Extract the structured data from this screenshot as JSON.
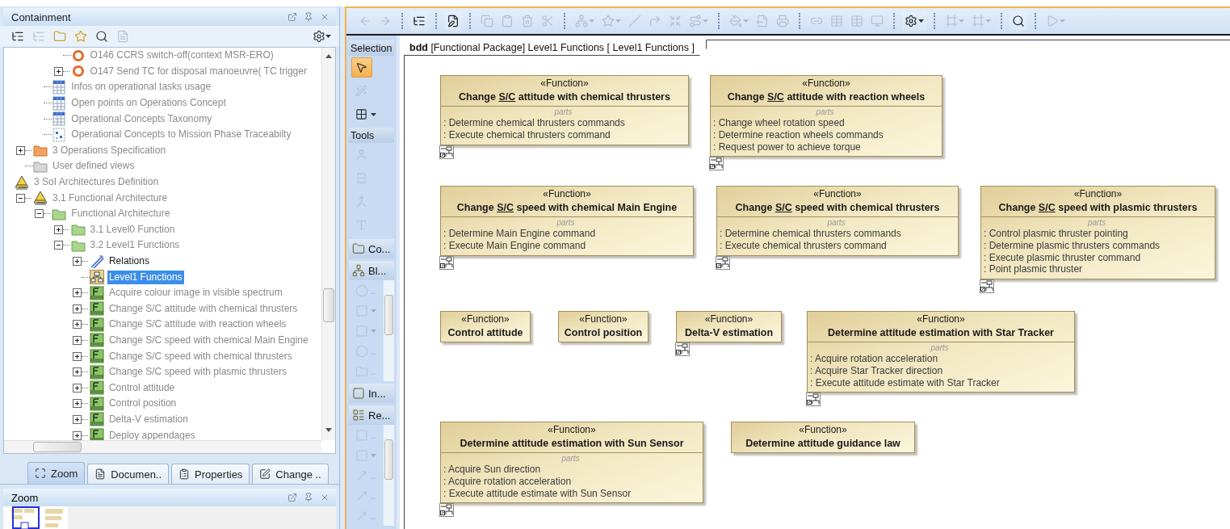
{
  "containment": {
    "title": "Containment",
    "tree": [
      {
        "children": [
          {
            "children": [
              {
                "children": [
                  {
                    "label": "O146 CCRS switch-off(context MSR-ERO)",
                    "kind": "operation",
                    "greyed": true,
                    "selected": false
                  },
                  {
                    "label": "O147 Send TC for disposal manoeuvre( TC trigger",
                    "kind": "operation",
                    "greyed": true,
                    "selected": false,
                    "expanded": false
                  }
                ]
              },
              {
                "label": "Infos on operational tasks usage",
                "kind": "table",
                "greyed": true,
                "selected": false
              },
              {
                "label": "Open points on Operations Concept",
                "kind": "table",
                "greyed": true,
                "selected": false
              },
              {
                "label": "Operational Concepts Taxonomy",
                "kind": "table",
                "greyed": true,
                "selected": false
              },
              {
                "label": "Operational Concepts to Mission Phase Traceabilty",
                "kind": "matrix",
                "greyed": true,
                "selected": false
              }
            ]
          },
          {
            "label": "3 Operations Specification",
            "kind": "specfolder",
            "greyed": true,
            "selected": false,
            "expanded": false
          },
          {
            "label": "User defined views",
            "kind": "folder",
            "greyed": true,
            "selected": false
          }
        ]
      },
      {
        "label": "3 SoI Architectures Definition",
        "kind": "model",
        "greyed": true,
        "selected": false,
        "children": [
          {
            "label": "3.1 Functional Architecture",
            "kind": "model",
            "greyed": true,
            "selected": false,
            "expanded": true,
            "children": [
              {
                "label": "Functional Architecture",
                "kind": "package",
                "greyed": true,
                "selected": false,
                "expanded": true,
                "children": [
                  {
                    "label": "3.1 Level0 Function",
                    "kind": "package",
                    "greyed": true,
                    "selected": false,
                    "expanded": false
                  },
                  {
                    "label": "3.2 Level1 Functions",
                    "kind": "package",
                    "greyed": true,
                    "selected": false,
                    "expanded": true,
                    "children": [
                      {
                        "label": "Relations",
                        "kind": "relation",
                        "greyed": false,
                        "selected": false,
                        "expanded": false
                      },
                      {
                        "label": "Level1 Functions",
                        "kind": "diagram",
                        "greyed": false,
                        "selected": true
                      },
                      {
                        "label": "Acquire colour image in visible spectrum",
                        "kind": "function",
                        "greyed": true,
                        "selected": false,
                        "expanded": false
                      },
                      {
                        "label": "Change S/C attitude with chemical thrusters",
                        "kind": "function",
                        "greyed": true,
                        "selected": false,
                        "expanded": false
                      },
                      {
                        "label": "Change S/C attitude with reaction wheels",
                        "kind": "function",
                        "greyed": true,
                        "selected": false,
                        "expanded": false
                      },
                      {
                        "label": "Change S/C speed with chemical Main Engine",
                        "kind": "function",
                        "greyed": true,
                        "selected": false,
                        "expanded": false
                      },
                      {
                        "label": "Change S/C speed with chemical thrusters",
                        "kind": "function",
                        "greyed": true,
                        "selected": false,
                        "expanded": false
                      },
                      {
                        "label": "Change S/C speed with plasmic thrusters",
                        "kind": "function",
                        "greyed": true,
                        "selected": false,
                        "expanded": false
                      },
                      {
                        "label": "Control attitude",
                        "kind": "function",
                        "greyed": true,
                        "selected": false,
                        "expanded": false
                      },
                      {
                        "label": "Control position",
                        "kind": "function",
                        "greyed": true,
                        "selected": false,
                        "expanded": false
                      },
                      {
                        "label": "Delta-V estimation",
                        "kind": "function",
                        "greyed": true,
                        "selected": false,
                        "expanded": false
                      },
                      {
                        "label": "Deploy appendages",
                        "kind": "function",
                        "greyed": true,
                        "selected": false,
                        "expanded": false
                      }
                    ]
                  }
                ]
              }
            ]
          }
        ]
      }
    ]
  },
  "bottom_tabs": [
    {
      "label": "Zoom",
      "kind": "zoom",
      "selected": true
    },
    {
      "label": "Documen..",
      "kind": "document",
      "selected": false
    },
    {
      "label": "Properties",
      "kind": "properties",
      "selected": false
    },
    {
      "label": "Change ..",
      "kind": "change",
      "selected": false
    }
  ],
  "zoom_panel": {
    "title": "Zoom"
  },
  "toolbar": [
    {
      "kind": "back",
      "disabled": true,
      "dropdown": false
    },
    {
      "kind": "forward",
      "disabled": true,
      "dropdown": false
    },
    {
      "kind": "separator"
    },
    {
      "kind": "tree",
      "disabled": false,
      "dropdown": false
    },
    {
      "kind": "separator"
    },
    {
      "kind": "edit",
      "disabled": false,
      "dropdown": false
    },
    {
      "kind": "separator"
    },
    {
      "kind": "copy",
      "disabled": true,
      "dropdown": false
    },
    {
      "kind": "paste",
      "disabled": true,
      "dropdown": false
    },
    {
      "kind": "delete",
      "disabled": true,
      "dropdown": false
    },
    {
      "kind": "cut",
      "disabled": true,
      "dropdown": false
    },
    {
      "kind": "separator"
    },
    {
      "kind": "layout",
      "disabled": true,
      "dropdown": true
    },
    {
      "kind": "star",
      "disabled": true,
      "dropdown": true
    },
    {
      "kind": "line",
      "disabled": true,
      "dropdown": false
    },
    {
      "kind": "path",
      "disabled": true,
      "dropdown": false
    },
    {
      "kind": "shrink",
      "disabled": true,
      "dropdown": false
    },
    {
      "kind": "route",
      "disabled": true,
      "dropdown": true
    },
    {
      "kind": "separator"
    },
    {
      "kind": "fill",
      "disabled": true,
      "dropdown": true
    },
    {
      "kind": "export",
      "disabled": true,
      "dropdown": false
    },
    {
      "kind": "print",
      "disabled": true,
      "dropdown": false
    },
    {
      "kind": "separator"
    },
    {
      "kind": "link",
      "disabled": true,
      "dropdown": false
    },
    {
      "kind": "table",
      "disabled": true,
      "dropdown": false
    },
    {
      "kind": "table",
      "disabled": true,
      "dropdown": false
    },
    {
      "kind": "monitor",
      "disabled": true,
      "dropdown": false
    },
    {
      "kind": "separator"
    },
    {
      "kind": "settings",
      "disabled": false,
      "dropdown": true
    },
    {
      "kind": "separator"
    },
    {
      "kind": "frame",
      "disabled": true,
      "dropdown": true
    },
    {
      "kind": "frame",
      "disabled": true,
      "dropdown": true
    },
    {
      "kind": "separator"
    },
    {
      "kind": "search",
      "disabled": false,
      "dropdown": false
    },
    {
      "kind": "separator"
    },
    {
      "kind": "play",
      "disabled": true,
      "dropdown": true
    }
  ],
  "palette": [
    {
      "title": "Selection",
      "tools": [
        {
          "kind": "pointer",
          "selected": true,
          "disabled": false,
          "dropdown": false
        },
        {
          "kind": "wand",
          "selected": false,
          "disabled": true,
          "dropdown": false
        },
        {
          "kind": "grid",
          "selected": false,
          "disabled": false,
          "dropdown": true
        }
      ]
    },
    {
      "title": "Tools",
      "tools": [
        {
          "kind": "person",
          "selected": false,
          "disabled": true,
          "dropdown": false
        },
        {
          "kind": "split",
          "selected": false,
          "disabled": true,
          "dropdown": false
        },
        {
          "kind": "merge",
          "selected": false,
          "disabled": true,
          "dropdown": false
        },
        {
          "kind": "text",
          "selected": false,
          "disabled": true,
          "dropdown": false
        }
      ]
    }
  ],
  "palette_groups": [
    {
      "label": "Co...",
      "kind": "folder"
    },
    {
      "label": "Bl...",
      "kind": "bdd",
      "items": [
        {
          "kind": "circle",
          "label": "..",
          "disabled": true
        },
        {
          "kind": "block",
          "dropdown": true,
          "disabled": true
        },
        {
          "kind": "block",
          "dropdown": true,
          "disabled": true
        },
        {
          "kind": "circle",
          "label": "..",
          "disabled": true
        },
        {
          "kind": "folder",
          "label": "..",
          "disabled": true
        }
      ]
    },
    {
      "label": "In...",
      "kind": "interface"
    },
    {
      "label": "Re...",
      "kind": "relations",
      "items": [
        {
          "kind": "block",
          "label": "..",
          "disabled": true
        },
        {
          "kind": "block",
          "dropdown": true,
          "disabled": true
        },
        {
          "kind": "arrow",
          "label": "..",
          "disabled": true
        },
        {
          "kind": "arrow",
          "label": "..",
          "disabled": true
        },
        {
          "kind": "arrow",
          "label": "..",
          "disabled": true
        }
      ]
    }
  ],
  "diagram": {
    "frame_label": "**bdd** [Functional Package] Level1 Functions [ Level1 Functions ]",
    "blocks": [
      {
        "stereotype": "«Function»",
        "title": [
          {
            "text": "Change ",
            "underline": false
          },
          {
            "text": "S/C",
            "underline": true
          },
          {
            "text": " attitude with chemical thrusters",
            "underline": false
          }
        ],
        "parts_label": "parts",
        "parts": [
          ": Determine chemical thrusters commands",
          ": Execute chemical thrusters command"
        ],
        "diagram_link": true
      },
      {
        "stereotype": "«Function»",
        "title": [
          {
            "text": "Change ",
            "underline": false
          },
          {
            "text": "S/C",
            "underline": true
          },
          {
            "text": " attitude with reaction wheels",
            "underline": false
          }
        ],
        "parts_label": "parts",
        "parts": [
          ": Change wheel rotation speed",
          ": Determine reaction wheels commands",
          ": Request power to achieve torque"
        ],
        "diagram_link": true
      },
      {
        "stereotype": "«Function»",
        "title": [
          {
            "text": "Change ",
            "underline": false
          },
          {
            "text": "S/C",
            "underline": true
          },
          {
            "text": " speed with chemical Main Engine",
            "underline": false
          }
        ],
        "parts_label": "parts",
        "parts": [
          ": Determine Main Engine command",
          ": Execute Main Engine command"
        ],
        "diagram_link": true
      },
      {
        "stereotype": "«Function»",
        "title": [
          {
            "text": "Change ",
            "underline": false
          },
          {
            "text": "S/C",
            "underline": true
          },
          {
            "text": " speed with chemical thrusters",
            "underline": false
          }
        ],
        "parts_label": "parts",
        "parts": [
          ": Determine chemical thrusters commands",
          ": Execute chemical thrusters command"
        ],
        "diagram_link": true
      },
      {
        "stereotype": "«Function»",
        "title": [
          {
            "text": "Change ",
            "underline": false
          },
          {
            "text": "S/C",
            "underline": true
          },
          {
            "text": " speed with plasmic thrusters",
            "underline": false
          }
        ],
        "parts_label": "parts",
        "parts": [
          ": Control plasmic thruster pointing",
          ": Determine plasmic thrusters commands",
          ": Execute plasmic thruster command",
          ": Point plasmic thruster"
        ],
        "diagram_link": true
      },
      {
        "stereotype": "«Function»",
        "title": [
          {
            "text": "Control attitude",
            "underline": false
          }
        ],
        "diagram_link": false
      },
      {
        "stereotype": "«Function»",
        "title": [
          {
            "text": "Control position",
            "underline": false
          }
        ],
        "diagram_link": false
      },
      {
        "stereotype": "«Function»",
        "title": [
          {
            "text": "Delta-V estimation",
            "underline": false
          }
        ],
        "diagram_link": true
      },
      {
        "stereotype": "«Function»",
        "title": [
          {
            "text": "Determine attitude estimation with Star Tracker",
            "underline": false
          }
        ],
        "parts_label": "parts",
        "parts": [
          ": Acquire rotation acceleration",
          ": Acquire Star Tracker direction",
          ": Execute attitude estimate with Star Tracker"
        ],
        "diagram_link": true
      },
      {
        "stereotype": "«Function»",
        "title": [
          {
            "text": "Determine attitude estimation with Sun Sensor",
            "underline": false
          }
        ],
        "parts_label": "parts",
        "parts": [
          ": Acquire Sun direction",
          ": Acquire rotation acceleration",
          ": Execute attitude estimate with Sun Sensor"
        ],
        "diagram_link": true
      },
      {
        "stereotype": "«Function»",
        "title": [
          {
            "text": "Determine attitude guidance law",
            "underline": false
          }
        ],
        "diagram_link": false
      }
    ]
  }
}
